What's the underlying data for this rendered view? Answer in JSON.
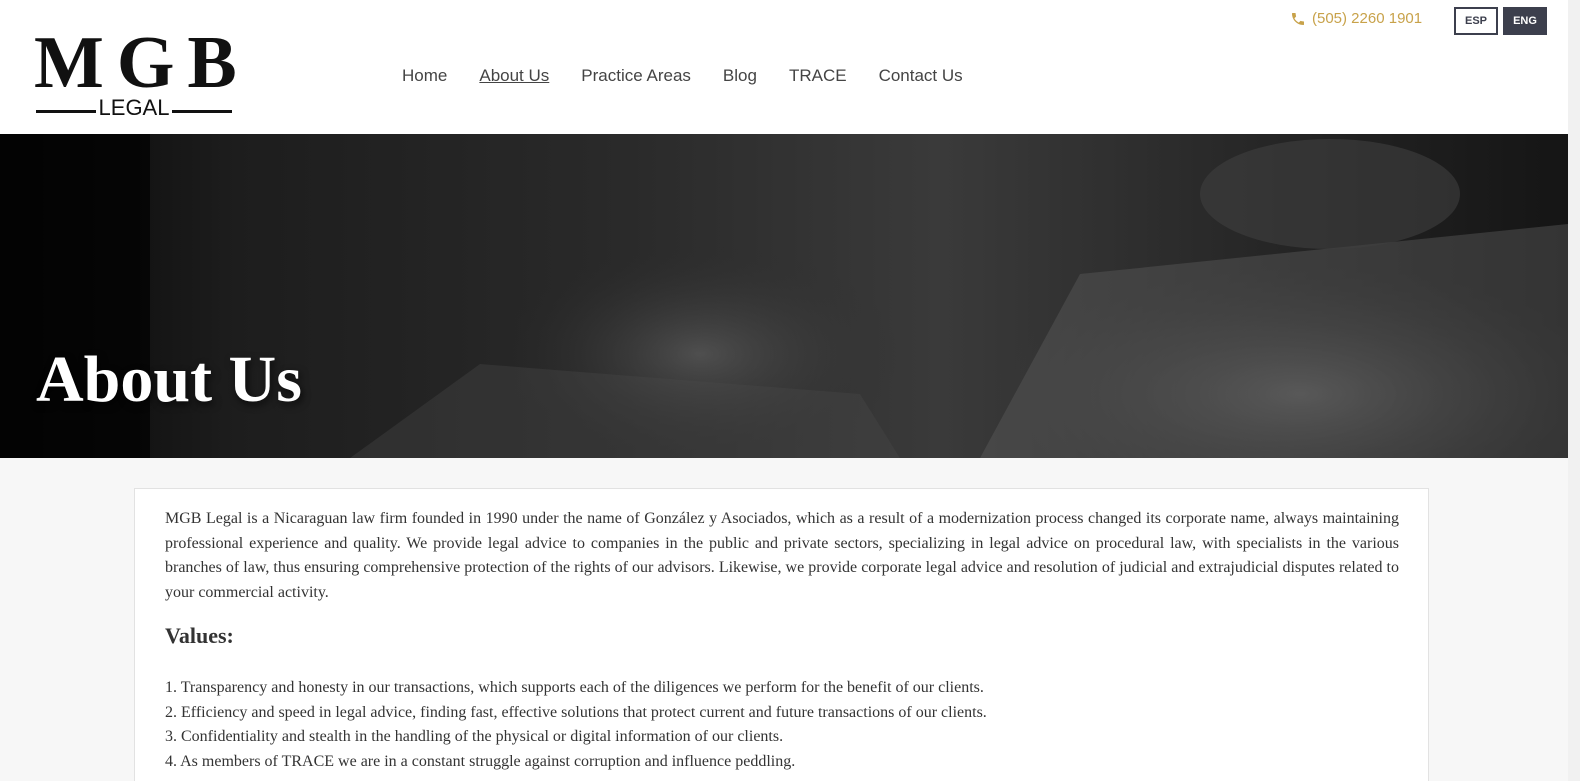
{
  "header": {
    "logo": {
      "main": "MGB",
      "sub": "LEGAL"
    },
    "nav": [
      {
        "label": "Home",
        "active": false
      },
      {
        "label": "About Us",
        "active": true
      },
      {
        "label": "Practice Areas",
        "active": false
      },
      {
        "label": "Blog",
        "active": false
      },
      {
        "label": "TRACE",
        "active": false
      },
      {
        "label": "Contact Us",
        "active": false
      }
    ],
    "phone": "(505) 2260 1901",
    "phone_icon": "phone-icon",
    "lang": {
      "esp": "ESP",
      "eng": "ENG"
    }
  },
  "hero": {
    "title": "About Us"
  },
  "content": {
    "intro": "MGB Legal is a Nicaraguan law firm founded in 1990 under the name of González y Asociados, which as a result of a modernization process changed its corporate name, always maintaining professional experience and quality. We provide legal advice to companies in the public and private sectors, specializing in legal advice on procedural law, with specialists in the various branches of law, thus ensuring comprehensive protection of the rights of our advisors. Likewise, we provide corporate legal advice and resolution of judicial and extrajudicial disputes related to your commercial activity.",
    "values_title": "Values:",
    "values": [
      "1. Transparency and honesty in our transactions, which supports each of the diligences we perform for the benefit of our clients.",
      "2. Efficiency and speed in legal advice, finding fast, effective solutions that protect current and future transactions of our clients.",
      "3. Confidentiality and stealth in the handling of the physical or digital information of our clients.",
      "4. As members of TRACE we are in a constant struggle against corruption and influence peddling."
    ]
  },
  "colors": {
    "accent": "#c8a24a",
    "dark": "#3c3f4d"
  }
}
